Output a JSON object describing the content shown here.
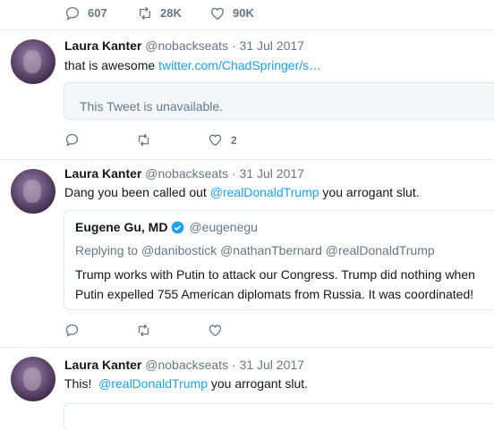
{
  "top_actions": {
    "replies": "607",
    "retweets": "28K",
    "likes": "90K"
  },
  "tweets": [
    {
      "name": "Laura Kanter",
      "handle": "@nobackseats",
      "dot": "·",
      "date": "31 Jul 2017",
      "text_before": "that is awesome ",
      "link": "twitter.com/ChadSpringer/s…",
      "text_after": "",
      "card_text": "This Tweet is unavailable.",
      "likes": "2"
    },
    {
      "name": "Laura Kanter",
      "handle": "@nobackseats",
      "dot": "·",
      "date": "31 Jul 2017",
      "text_before": "Dang you been called out ",
      "link": "@realDonaldTrump",
      "text_after": " you arrogant slut.",
      "quote": {
        "name": "Eugene Gu, MD",
        "handle": "@eugenegu",
        "replying_label": "Replying to",
        "replying_to": "@danibostick @nathanTbernard @realDonaldTrump",
        "line1": "Trump works with Putin to attack our Congress. Trump did nothing when",
        "line2": "Putin expelled 755 American diplomats from Russia. It was coordinated!"
      }
    },
    {
      "name": "Laura Kanter",
      "handle": "@nobackseats",
      "dot": "·",
      "date": "31 Jul 2017",
      "text_before": "This!  ",
      "link": "@realDonaldTrump",
      "text_after": " you arrogant slut."
    }
  ],
  "colors": {
    "link": "#1da1f2",
    "muted": "#657786",
    "border": "#e6ecf0",
    "verified": "#1da1f2"
  },
  "icons": {
    "reply": "reply-icon",
    "retweet": "retweet-icon",
    "like": "heart-icon",
    "verified": "verified-badge-icon"
  }
}
